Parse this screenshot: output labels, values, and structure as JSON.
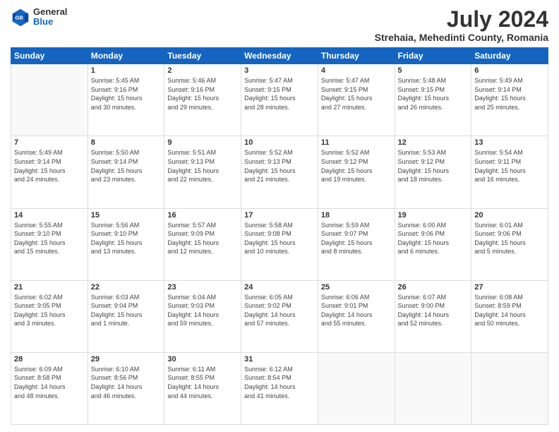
{
  "header": {
    "logo_line1": "General",
    "logo_line2": "Blue",
    "title": "July 2024",
    "subtitle": "Strehaia, Mehedinti County, Romania"
  },
  "weekdays": [
    "Sunday",
    "Monday",
    "Tuesday",
    "Wednesday",
    "Thursday",
    "Friday",
    "Saturday"
  ],
  "weeks": [
    [
      {
        "day": "",
        "info": ""
      },
      {
        "day": "1",
        "info": "Sunrise: 5:45 AM\nSunset: 9:16 PM\nDaylight: 15 hours\nand 30 minutes."
      },
      {
        "day": "2",
        "info": "Sunrise: 5:46 AM\nSunset: 9:16 PM\nDaylight: 15 hours\nand 29 minutes."
      },
      {
        "day": "3",
        "info": "Sunrise: 5:47 AM\nSunset: 9:15 PM\nDaylight: 15 hours\nand 28 minutes."
      },
      {
        "day": "4",
        "info": "Sunrise: 5:47 AM\nSunset: 9:15 PM\nDaylight: 15 hours\nand 27 minutes."
      },
      {
        "day": "5",
        "info": "Sunrise: 5:48 AM\nSunset: 9:15 PM\nDaylight: 15 hours\nand 26 minutes."
      },
      {
        "day": "6",
        "info": "Sunrise: 5:49 AM\nSunset: 9:14 PM\nDaylight: 15 hours\nand 25 minutes."
      }
    ],
    [
      {
        "day": "7",
        "info": "Sunrise: 5:49 AM\nSunset: 9:14 PM\nDaylight: 15 hours\nand 24 minutes."
      },
      {
        "day": "8",
        "info": "Sunrise: 5:50 AM\nSunset: 9:14 PM\nDaylight: 15 hours\nand 23 minutes."
      },
      {
        "day": "9",
        "info": "Sunrise: 5:51 AM\nSunset: 9:13 PM\nDaylight: 15 hours\nand 22 minutes."
      },
      {
        "day": "10",
        "info": "Sunrise: 5:52 AM\nSunset: 9:13 PM\nDaylight: 15 hours\nand 21 minutes."
      },
      {
        "day": "11",
        "info": "Sunrise: 5:52 AM\nSunset: 9:12 PM\nDaylight: 15 hours\nand 19 minutes."
      },
      {
        "day": "12",
        "info": "Sunrise: 5:53 AM\nSunset: 9:12 PM\nDaylight: 15 hours\nand 18 minutes."
      },
      {
        "day": "13",
        "info": "Sunrise: 5:54 AM\nSunset: 9:11 PM\nDaylight: 15 hours\nand 16 minutes."
      }
    ],
    [
      {
        "day": "14",
        "info": "Sunrise: 5:55 AM\nSunset: 9:10 PM\nDaylight: 15 hours\nand 15 minutes."
      },
      {
        "day": "15",
        "info": "Sunrise: 5:56 AM\nSunset: 9:10 PM\nDaylight: 15 hours\nand 13 minutes."
      },
      {
        "day": "16",
        "info": "Sunrise: 5:57 AM\nSunset: 9:09 PM\nDaylight: 15 hours\nand 12 minutes."
      },
      {
        "day": "17",
        "info": "Sunrise: 5:58 AM\nSunset: 9:08 PM\nDaylight: 15 hours\nand 10 minutes."
      },
      {
        "day": "18",
        "info": "Sunrise: 5:59 AM\nSunset: 9:07 PM\nDaylight: 15 hours\nand 8 minutes."
      },
      {
        "day": "19",
        "info": "Sunrise: 6:00 AM\nSunset: 9:06 PM\nDaylight: 15 hours\nand 6 minutes."
      },
      {
        "day": "20",
        "info": "Sunrise: 6:01 AM\nSunset: 9:06 PM\nDaylight: 15 hours\nand 5 minutes."
      }
    ],
    [
      {
        "day": "21",
        "info": "Sunrise: 6:02 AM\nSunset: 9:05 PM\nDaylight: 15 hours\nand 3 minutes."
      },
      {
        "day": "22",
        "info": "Sunrise: 6:03 AM\nSunset: 9:04 PM\nDaylight: 15 hours\nand 1 minute."
      },
      {
        "day": "23",
        "info": "Sunrise: 6:04 AM\nSunset: 9:03 PM\nDaylight: 14 hours\nand 59 minutes."
      },
      {
        "day": "24",
        "info": "Sunrise: 6:05 AM\nSunset: 9:02 PM\nDaylight: 14 hours\nand 57 minutes."
      },
      {
        "day": "25",
        "info": "Sunrise: 6:06 AM\nSunset: 9:01 PM\nDaylight: 14 hours\nand 55 minutes."
      },
      {
        "day": "26",
        "info": "Sunrise: 6:07 AM\nSunset: 9:00 PM\nDaylight: 14 hours\nand 52 minutes."
      },
      {
        "day": "27",
        "info": "Sunrise: 6:08 AM\nSunset: 8:59 PM\nDaylight: 14 hours\nand 50 minutes."
      }
    ],
    [
      {
        "day": "28",
        "info": "Sunrise: 6:09 AM\nSunset: 8:58 PM\nDaylight: 14 hours\nand 48 minutes."
      },
      {
        "day": "29",
        "info": "Sunrise: 6:10 AM\nSunset: 8:56 PM\nDaylight: 14 hours\nand 46 minutes."
      },
      {
        "day": "30",
        "info": "Sunrise: 6:11 AM\nSunset: 8:55 PM\nDaylight: 14 hours\nand 44 minutes."
      },
      {
        "day": "31",
        "info": "Sunrise: 6:12 AM\nSunset: 8:54 PM\nDaylight: 14 hours\nand 41 minutes."
      },
      {
        "day": "",
        "info": ""
      },
      {
        "day": "",
        "info": ""
      },
      {
        "day": "",
        "info": ""
      }
    ]
  ]
}
